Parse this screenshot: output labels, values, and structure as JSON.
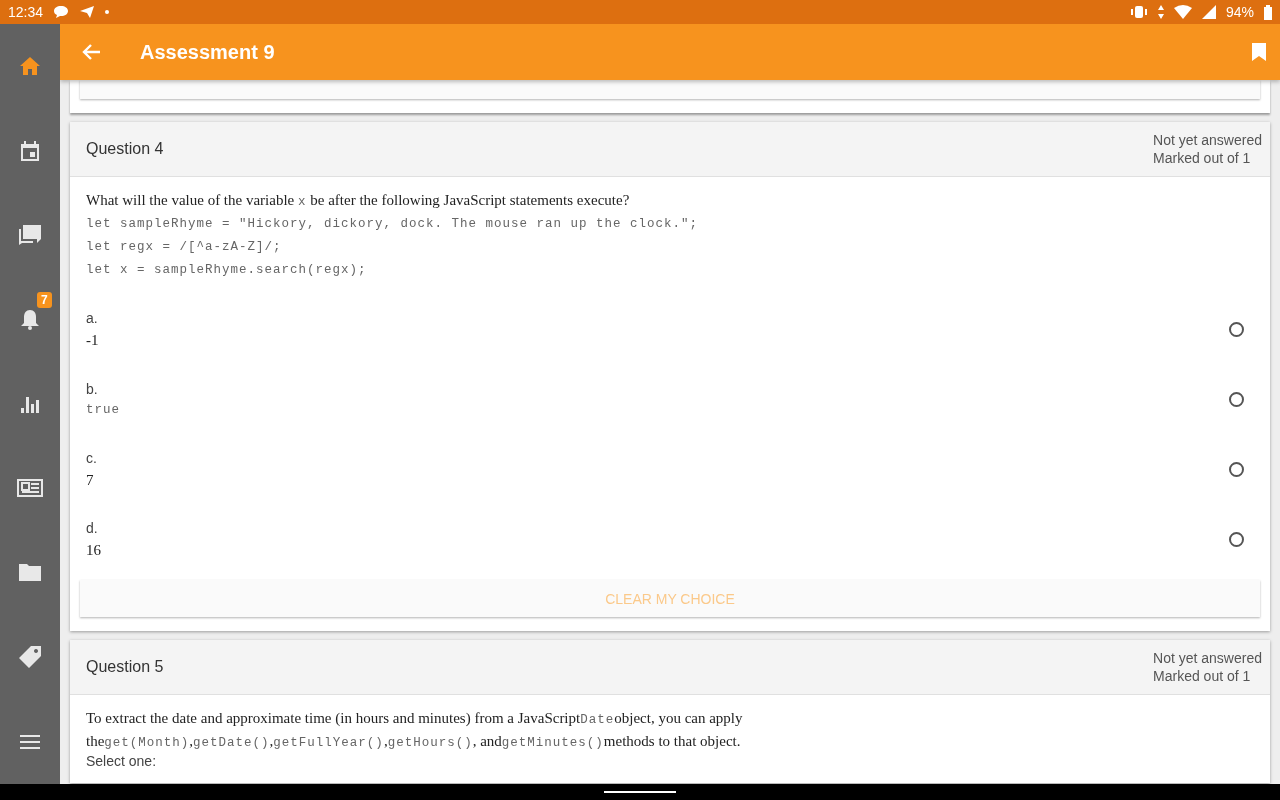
{
  "status_bar": {
    "time": "12:34",
    "battery": "94%"
  },
  "sidebar": {
    "items": [
      {
        "selected": true
      },
      {
        "selected": false
      },
      {
        "selected": false
      },
      {
        "selected": false,
        "badge": "7"
      },
      {
        "selected": false
      },
      {
        "selected": false
      },
      {
        "selected": false
      },
      {
        "selected": false
      },
      {
        "selected": false
      }
    ]
  },
  "app_bar": {
    "title": "Assessment 9"
  },
  "questions": [
    {
      "title": "Question 4",
      "status": "Not yet answered",
      "marks": "Marked out of 1",
      "prompt": [
        [
          {
            "kind": "text",
            "text": "What will the value of the variable "
          },
          {
            "kind": "code",
            "text": "x"
          },
          {
            "kind": "text",
            "text": " be after the following JavaScript statements execute?"
          }
        ]
      ],
      "code_lines": [
        "let sampleRhyme = \"Hickory, dickory, dock. The mouse ran up the clock.\";",
        "let regx = /[^a-zA-Z]/;",
        "let x = sampleRhyme.search(regx);"
      ],
      "options": [
        {
          "letter": "a.",
          "value": "-1",
          "kind": "text",
          "selected": false
        },
        {
          "letter": "b.",
          "value": "true",
          "kind": "code",
          "selected": false
        },
        {
          "letter": "c.",
          "value": "7",
          "kind": "text",
          "selected": false
        },
        {
          "letter": "d.",
          "value": "16",
          "kind": "text",
          "selected": false
        }
      ],
      "clear_button": "CLEAR MY CHOICE"
    },
    {
      "title": "Question 5",
      "status": "Not yet answered",
      "marks": "Marked out of 1",
      "prompt": [
        [
          {
            "kind": "text",
            "text": "To extract the date and approximate time (in hours and minutes) from a JavaScript"
          },
          {
            "kind": "code",
            "text": "Date"
          },
          {
            "kind": "text",
            "text": "object, you can apply"
          }
        ],
        [
          {
            "kind": "text",
            "text": "the"
          },
          {
            "kind": "code",
            "text": "get(Month)"
          },
          {
            "kind": "text",
            "text": ","
          },
          {
            "kind": "code",
            "text": "getDate()"
          },
          {
            "kind": "text",
            "text": ","
          },
          {
            "kind": "code",
            "text": "getFullYear()"
          },
          {
            "kind": "text",
            "text": ","
          },
          {
            "kind": "code",
            "text": "getHours()"
          },
          {
            "kind": "text",
            "text": ", and"
          },
          {
            "kind": "code",
            "text": "getMinutes()"
          },
          {
            "kind": "text",
            "text": "methods to that object."
          }
        ]
      ],
      "instruction": "Select one:"
    }
  ]
}
